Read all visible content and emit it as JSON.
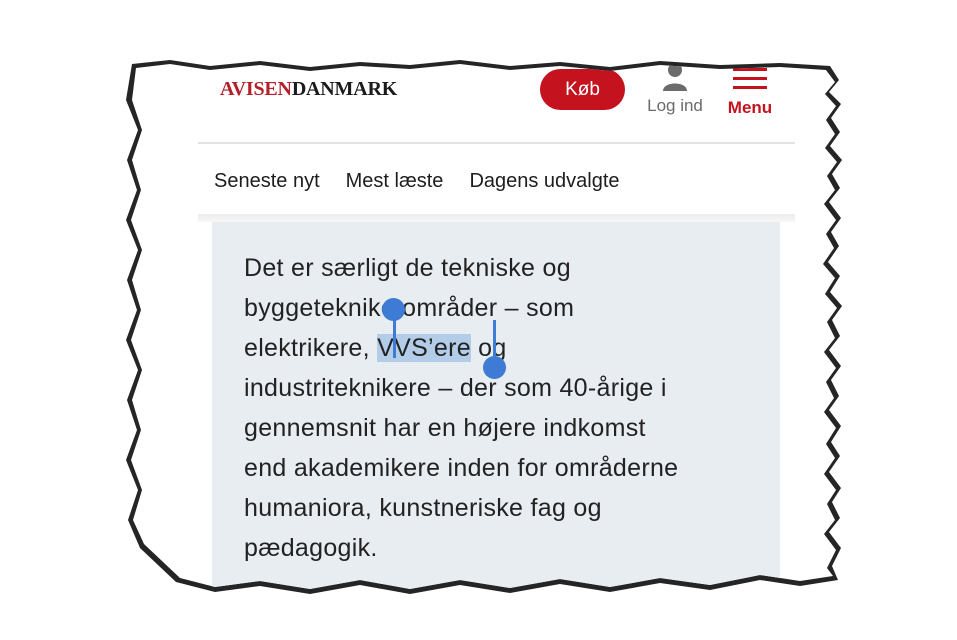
{
  "header": {
    "logo_part1": "AVISEN",
    "logo_part2": "DANMARK",
    "buy_label": "Køb",
    "login_label": "Log ind",
    "menu_label": "Menu",
    "login_icon": "user-icon",
    "menu_icon": "hamburger-icon"
  },
  "nav": {
    "items": [
      "Seneste nyt",
      "Mest læste",
      "Dagens udvalgte"
    ]
  },
  "article": {
    "line1": "Det er særligt de tekniske og",
    "line2a": "byggetekni",
    "line2b": "ke områder – som",
    "line3a": "elektrikere, ",
    "selected": "VVS’ere",
    "line3b": " og",
    "line4a": "industriteknikere – ",
    "line4b": "der som 40-årige i",
    "line5": "gennemsnit har en højere indkomst",
    "line6": "end akademikere inden for områderne",
    "line7": "humaniora, kunstneriske fag og",
    "line8": "pædagogik."
  },
  "colors": {
    "brand_red": "#c4121f",
    "selection": "#b3cde8",
    "handle_blue": "#3d7bd4",
    "article_bg": "#e8edf2"
  }
}
